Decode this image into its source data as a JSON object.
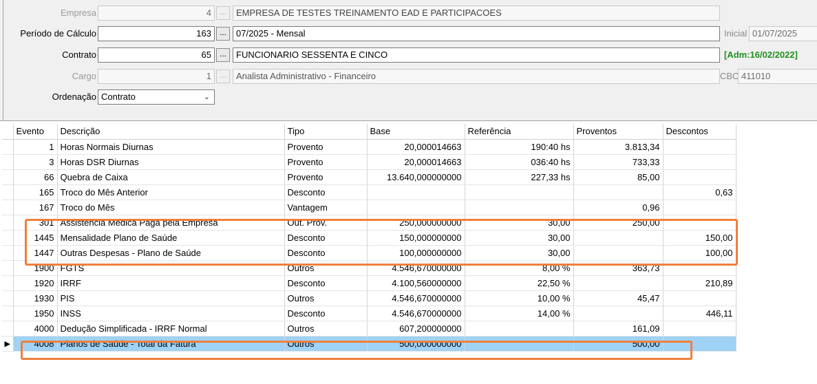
{
  "form": {
    "empresa": {
      "label": "Empresa",
      "code": "4",
      "name": "EMPRESA DE TESTES TREINAMENTO EAD E PARTICIPACOES"
    },
    "periodo": {
      "label": "Período de Cálculo",
      "code": "163",
      "name": "07/2025 - Mensal",
      "side_label": "Inicial",
      "side_value": "01/07/2025"
    },
    "contrato": {
      "label": "Contrato",
      "code": "65",
      "name": "FUNCIONARIO SESSENTA E CINCO",
      "admission": "[Adm:16/02/2022]"
    },
    "cargo": {
      "label": "Cargo",
      "code": "1",
      "name": "Analista Administrativo - Financeiro",
      "side_label": "CBO",
      "side_value": "411010"
    },
    "ordenacao": {
      "label": "Ordenação",
      "value": "Contrato"
    },
    "ellipsis": "..."
  },
  "grid": {
    "columns": [
      "Evento",
      "Descrição",
      "Tipo",
      "Base",
      "Referência",
      "Proventos",
      "Descontos"
    ],
    "rows": [
      {
        "evento": "1",
        "descricao": "Horas Normais Diurnas",
        "tipo": "Provento",
        "base": "20,000014663",
        "referencia": "190:40 hs",
        "proventos": "3.813,34",
        "descontos": ""
      },
      {
        "evento": "3",
        "descricao": "Horas DSR Diurnas",
        "tipo": "Provento",
        "base": "20,000014663",
        "referencia": "036:40 hs",
        "proventos": "733,33",
        "descontos": ""
      },
      {
        "evento": "66",
        "descricao": "Quebra de Caixa",
        "tipo": "Provento",
        "base": "13.640,000000000",
        "referencia": "227,33 hs",
        "proventos": "85,00",
        "descontos": ""
      },
      {
        "evento": "165",
        "descricao": "Troco do Mês Anterior",
        "tipo": "Desconto",
        "base": "",
        "referencia": "",
        "proventos": "",
        "descontos": "0,63"
      },
      {
        "evento": "167",
        "descricao": "Troco do Mês",
        "tipo": "Vantagem",
        "base": "",
        "referencia": "",
        "proventos": "0,96",
        "descontos": ""
      },
      {
        "evento": "301",
        "descricao": "Assistência Médica Paga pela Empresa",
        "tipo": "Out. Prov.",
        "base": "250,000000000",
        "referencia": "30,00",
        "proventos": "250,00",
        "descontos": ""
      },
      {
        "evento": "1445",
        "descricao": "Mensalidade  Plano de Saúde",
        "tipo": "Desconto",
        "base": "150,000000000",
        "referencia": "30,00",
        "proventos": "",
        "descontos": "150,00"
      },
      {
        "evento": "1447",
        "descricao": "Outras Despesas - Plano de Saúde",
        "tipo": "Desconto",
        "base": "100,000000000",
        "referencia": "30,00",
        "proventos": "",
        "descontos": "100,00"
      },
      {
        "evento": "1900",
        "descricao": "FGTS",
        "tipo": "Outros",
        "base": "4.546,670000000",
        "referencia": "8,00 %",
        "proventos": "363,73",
        "descontos": ""
      },
      {
        "evento": "1920",
        "descricao": "IRRF",
        "tipo": "Desconto",
        "base": "4.100,560000000",
        "referencia": "22,50 %",
        "proventos": "",
        "descontos": "210,89"
      },
      {
        "evento": "1930",
        "descricao": "PIS",
        "tipo": "Outros",
        "base": "4.546,670000000",
        "referencia": "10,00 %",
        "proventos": "45,47",
        "descontos": ""
      },
      {
        "evento": "1950",
        "descricao": "INSS",
        "tipo": "Desconto",
        "base": "4.546,670000000",
        "referencia": "14,00 %",
        "proventos": "",
        "descontos": "446,11"
      },
      {
        "evento": "4000",
        "descricao": "Dedução Simplificada - IRRF Normal",
        "tipo": "Outros",
        "base": "607,200000000",
        "referencia": "",
        "proventos": "161,09",
        "descontos": ""
      },
      {
        "evento": "4008",
        "descricao": "Planos de Saúde - Total da Fatura",
        "tipo": "Outros",
        "base": "500,000000000",
        "referencia": "",
        "proventos": "500,00",
        "descontos": "",
        "selected": true
      }
    ]
  },
  "colors": {
    "highlight": "#f07f3c",
    "selected_row": "#9fd2f4",
    "admission": "#1f8f1f"
  },
  "icons": {
    "row_indicator": "triangle-right-icon",
    "dropdown": "chevron-down-icon"
  }
}
